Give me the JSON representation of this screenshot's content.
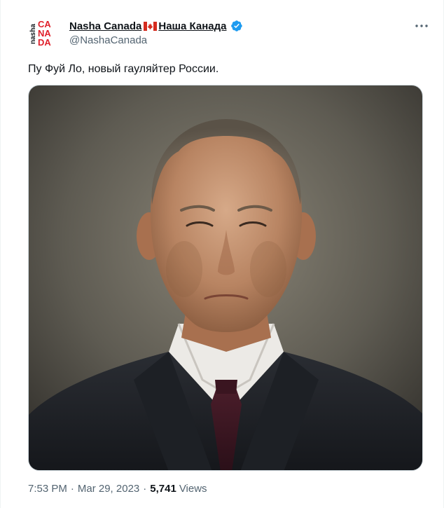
{
  "author": {
    "display_name": "Nasha Canada",
    "display_name_ru": "Наша Канада",
    "handle": "@NashaCanada",
    "avatar_text": {
      "prefix": "nasha",
      "line1": "CA",
      "line2": "NA",
      "line3": "DA"
    }
  },
  "tweet": {
    "text": "Пу Фуй Ло, новый гауляйтер России."
  },
  "meta": {
    "time": "7:53 PM",
    "separator": "·",
    "date": "Mar 29, 2023",
    "views_count": "5,741",
    "views_label": "Views"
  },
  "icons": {
    "more": "more-dots-icon",
    "verified": "verified-badge-icon",
    "flag": "canada-flag-icon"
  },
  "colors": {
    "text_primary": "#0f1419",
    "text_secondary": "#536471",
    "verified_blue": "#1d9bf0",
    "avatar_red": "#e0202b",
    "border": "#cfd9de"
  }
}
